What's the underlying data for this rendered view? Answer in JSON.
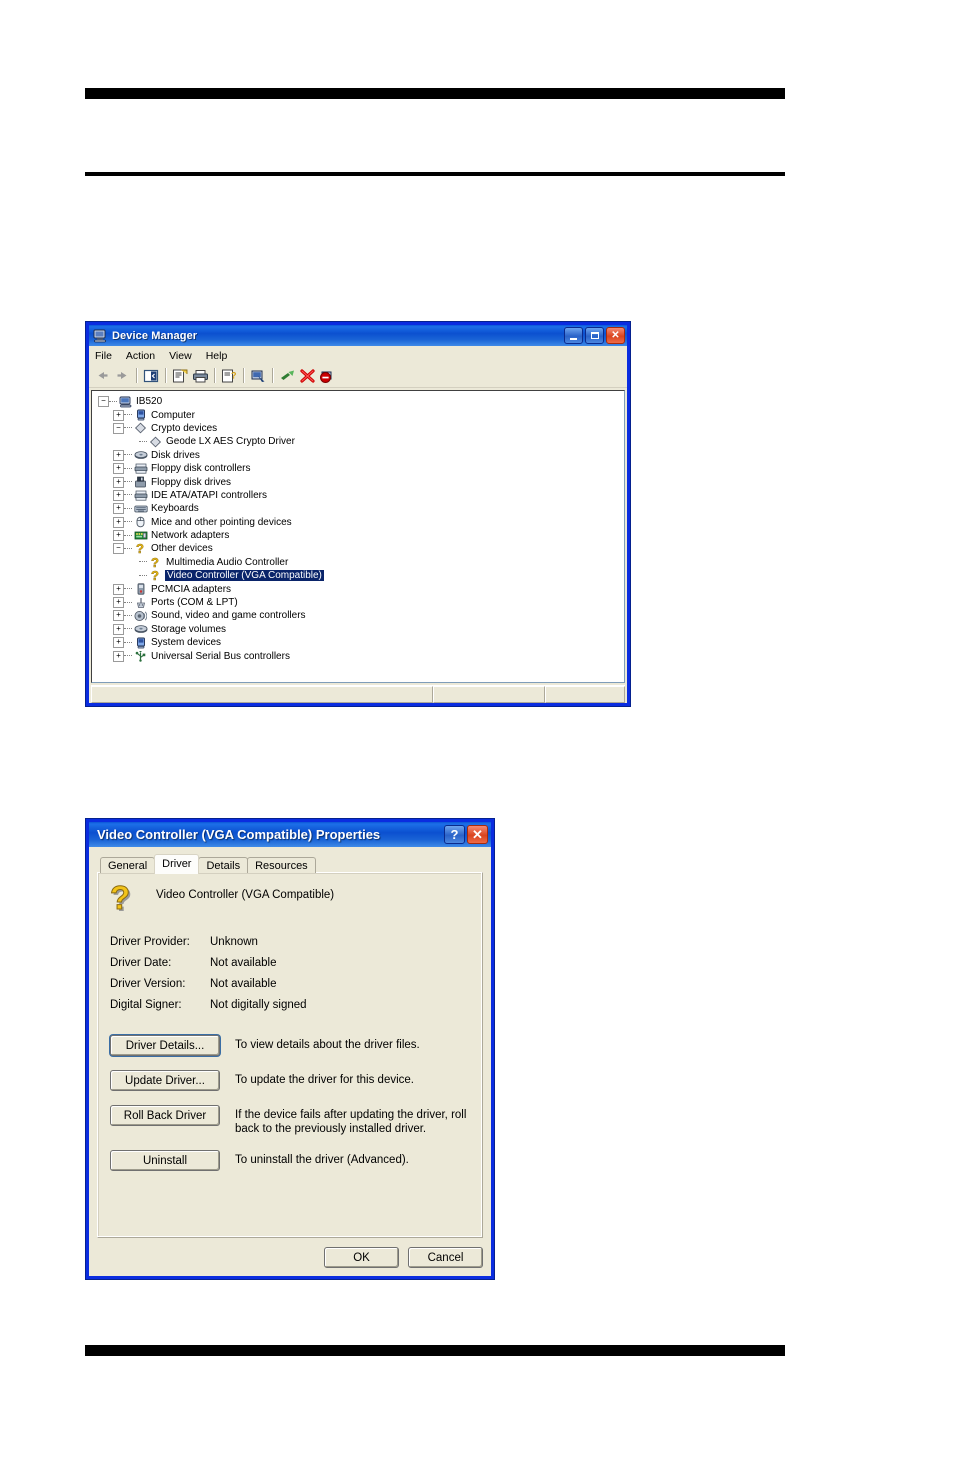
{
  "page": {
    "rules": [
      "top-black-bar",
      "double-rule",
      "bottom-black-bar"
    ]
  },
  "device_manager": {
    "title": "Device Manager",
    "title_icon": "computer-monitor-icon",
    "window_buttons": [
      {
        "name": "minimize",
        "glyph": "_"
      },
      {
        "name": "maximize",
        "glyph": "□"
      },
      {
        "name": "close",
        "glyph": "✕"
      }
    ],
    "menu": [
      "File",
      "Action",
      "View",
      "Help"
    ],
    "toolbar": [
      {
        "name": "back-icon"
      },
      {
        "name": "forward-icon"
      },
      {
        "name": "show-hide-tree-icon"
      },
      {
        "name": "properties-icon"
      },
      {
        "name": "print-icon"
      },
      {
        "name": "help-properties-icon"
      },
      {
        "name": "scan-hardware-icon"
      },
      {
        "name": "update-driver-icon"
      },
      {
        "name": "disable-device-icon"
      },
      {
        "name": "uninstall-device-icon"
      }
    ],
    "tree": [
      {
        "label": "IB520",
        "depth": 0,
        "expander": "minus",
        "icon": "computer-root-icon"
      },
      {
        "label": "Computer",
        "depth": 1,
        "expander": "plus",
        "icon": "computer-icon"
      },
      {
        "label": "Crypto devices",
        "depth": 1,
        "expander": "minus",
        "icon": "crypto-icon"
      },
      {
        "label": "Geode LX AES Crypto Driver",
        "depth": 2,
        "expander": "none",
        "icon": "crypto-icon"
      },
      {
        "label": "Disk drives",
        "depth": 1,
        "expander": "plus",
        "icon": "disk-drive-icon"
      },
      {
        "label": "Floppy disk controllers",
        "depth": 1,
        "expander": "plus",
        "icon": "controller-icon"
      },
      {
        "label": "Floppy disk drives",
        "depth": 1,
        "expander": "plus",
        "icon": "floppy-icon"
      },
      {
        "label": "IDE ATA/ATAPI controllers",
        "depth": 1,
        "expander": "plus",
        "icon": "controller-icon"
      },
      {
        "label": "Keyboards",
        "depth": 1,
        "expander": "plus",
        "icon": "keyboard-icon"
      },
      {
        "label": "Mice and other pointing devices",
        "depth": 1,
        "expander": "plus",
        "icon": "mouse-icon"
      },
      {
        "label": "Network adapters",
        "depth": 1,
        "expander": "plus",
        "icon": "network-adapter-icon"
      },
      {
        "label": "Other devices",
        "depth": 1,
        "expander": "minus",
        "icon": "question-mark-icon"
      },
      {
        "label": "Multimedia Audio Controller",
        "depth": 2,
        "expander": "none",
        "icon": "question-mark-icon"
      },
      {
        "label": "Video Controller (VGA Compatible)",
        "depth": 2,
        "expander": "none",
        "icon": "question-mark-icon",
        "selected": true
      },
      {
        "label": "PCMCIA adapters",
        "depth": 1,
        "expander": "plus",
        "icon": "pcmcia-icon"
      },
      {
        "label": "Ports (COM & LPT)",
        "depth": 1,
        "expander": "plus",
        "icon": "port-icon"
      },
      {
        "label": "Sound, video and game controllers",
        "depth": 1,
        "expander": "plus",
        "icon": "speaker-icon"
      },
      {
        "label": "Storage volumes",
        "depth": 1,
        "expander": "plus",
        "icon": "disk-drive-icon"
      },
      {
        "label": "System devices",
        "depth": 1,
        "expander": "plus",
        "icon": "computer-icon"
      },
      {
        "label": "Universal Serial Bus controllers",
        "depth": 1,
        "expander": "plus",
        "icon": "usb-icon"
      }
    ],
    "status_bar": [
      "",
      "",
      ""
    ]
  },
  "properties_dialog": {
    "title": "Video Controller (VGA Compatible) Properties",
    "window_buttons": [
      {
        "name": "help",
        "glyph": "?"
      },
      {
        "name": "close",
        "glyph": "✕"
      }
    ],
    "tabs": [
      {
        "label": "General",
        "active": false
      },
      {
        "label": "Driver",
        "active": true
      },
      {
        "label": "Details",
        "active": false
      },
      {
        "label": "Resources",
        "active": false
      }
    ],
    "device_icon": "question-mark-icon",
    "device_name": "Video Controller (VGA Compatible)",
    "fields": [
      {
        "key": "Driver Provider:",
        "value": "Unknown"
      },
      {
        "key": "Driver Date:",
        "value": "Not available"
      },
      {
        "key": "Driver Version:",
        "value": "Not available"
      },
      {
        "key": "Digital Signer:",
        "value": "Not digitally signed"
      }
    ],
    "actions": [
      {
        "button": "Driver Details...",
        "accel": "D",
        "default": true,
        "description": "To view details about the driver files."
      },
      {
        "button": "Update Driver...",
        "accel": "p",
        "default": false,
        "description": "To update the driver for this device."
      },
      {
        "button": "Roll Back Driver",
        "accel": "R",
        "default": false,
        "description": "If the device fails after updating the driver, roll back to the previously installed driver."
      },
      {
        "button": "Uninstall",
        "accel": "U",
        "default": false,
        "description": "To uninstall the driver (Advanced)."
      }
    ],
    "footer": {
      "ok_label": "OK",
      "cancel_label": "Cancel"
    }
  },
  "colors": {
    "titlebar_blue": "#0a50d0",
    "window_frame": "#0a2ce0",
    "dialog_face": "#ece9d8",
    "selection": "#0a246a",
    "close_red": "#d9441f",
    "warning_yellow": "#ffd700"
  }
}
